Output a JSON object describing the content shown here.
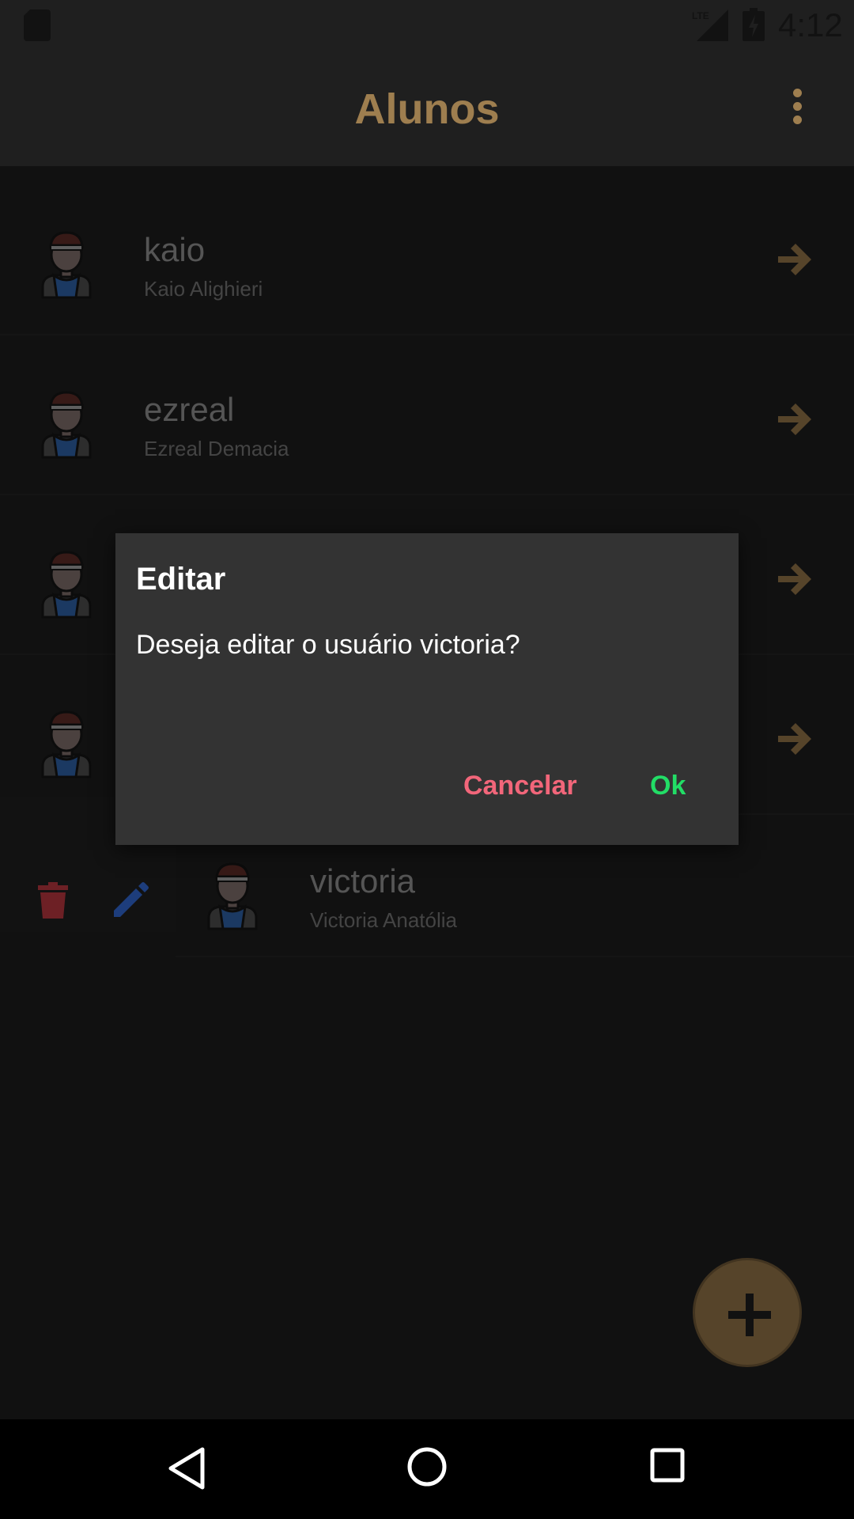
{
  "status_bar": {
    "time": "4:12",
    "network": "LTE"
  },
  "app_bar": {
    "title": "Alunos"
  },
  "students": [
    {
      "username": "kaio",
      "full_name": "Kaio Alighieri"
    },
    {
      "username": "ezreal",
      "full_name": "Ezreal Demacia"
    },
    {
      "username": "",
      "full_name": ""
    },
    {
      "username": "",
      "full_name": ""
    }
  ],
  "swiped_student": {
    "username": "victoria",
    "full_name": "Victoria Anatólia"
  },
  "dialog": {
    "title": "Editar",
    "message": "Deseja editar o usuário victoria?",
    "cancel_label": "Cancelar",
    "ok_label": "Ok"
  },
  "colors": {
    "accent": "#ffcc80",
    "cancel": "#f2667a",
    "ok": "#22dd66",
    "fab": "#8c6f44",
    "delete": "#b0343c",
    "edit": "#2f63c8"
  },
  "icons": {
    "overflow": "more-vert-icon",
    "row_action": "arrow-right-icon",
    "delete": "trash-icon",
    "edit": "pencil-icon",
    "fab": "plus-icon"
  }
}
